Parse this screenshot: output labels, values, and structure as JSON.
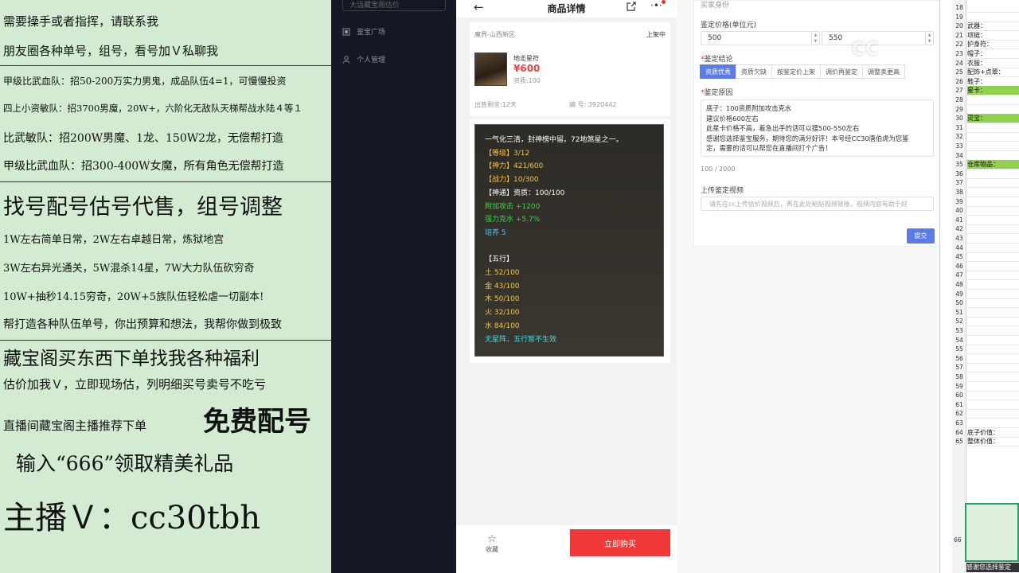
{
  "overlay": {
    "lines": [
      "需要操手或者指挥，请联系我",
      "朋友圈各种单号，组号，看号加Ｖ私聊我",
      "甲级比武血队：招50-200万实力男鬼，成品队伍4=1，可慢慢投资",
      "四上小资敏队：招3700男魔，20W+，六阶化无敌队天梯帮战水陆４等１",
      "比武敏队：招200W男魔、1龙、150W2龙，无偿帮打造",
      "甲级比武血队：招300-400W女魔，所有角色无偿帮打造",
      "找号配号估号代售，组号调整",
      "1W左右简单日常，2W左右卓越日常，炼狱地宫",
      "3W左右异光通关，5W混杀14星，7W大力队伍砍穷奇",
      "10W+抽秒14.15穷奇，20W+5族队伍轻松虐一切副本!",
      "帮打造各种队伍单号，你出预算和想法，我帮你做到极致",
      "藏宝阁买东西下单找我各种福利",
      "估价加我Ｖ，立即现场估，列明细买号卖号不吃亏",
      "直播间藏宝阁主播推荐下单",
      "免费配号",
      "输入“666”领取精美礼品",
      "主播Ｖ：cc30tbh"
    ]
  },
  "sidebar": {
    "search_placeholder": "大话藏宝阁估价",
    "items": [
      {
        "label": "鉴宝广场",
        "icon": "gallery-icon"
      },
      {
        "label": "个人管理",
        "icon": "user-icon"
      }
    ]
  },
  "phone": {
    "title": "商品详情",
    "region": "魔界-山西新区",
    "status": "上架中",
    "product_name": "地走星符",
    "price": "¥600",
    "points": "资质:100",
    "days_left": "出售剩余:12天",
    "serial": "编 号: 3920442",
    "detail_lines": [
      {
        "text": "一气化三清，封神榜中留。72地煞星之一。",
        "color": "#ffffff"
      },
      {
        "text": "【等级】3/12",
        "color": "#f5c542"
      },
      {
        "text": "【神力】421/600",
        "color": "#f5c542"
      },
      {
        "text": "【战力】10/300",
        "color": "#f5c542"
      },
      {
        "text": "【神通】资质：100/100",
        "color": "#ffffff"
      },
      {
        "text": "附加攻击 +1200",
        "color": "#38d64a"
      },
      {
        "text": "强力克水 +5.7%",
        "color": "#38d64a"
      },
      {
        "text": "培养 5",
        "color": "#4fc3ff"
      },
      {
        "text": "",
        "color": "#ffffff"
      },
      {
        "text": "【五行】",
        "color": "#ffffff"
      },
      {
        "text": "土 52/100",
        "color": "#f5c542"
      },
      {
        "text": "金 43/100",
        "color": "#f5c542"
      },
      {
        "text": "木 50/100",
        "color": "#f5c542"
      },
      {
        "text": "火 32/100",
        "color": "#f5c542"
      },
      {
        "text": "水 84/100",
        "color": "#f5c542"
      },
      {
        "text": "无星阵，五行暂不生效",
        "color": "#3de0e8"
      }
    ],
    "fav_label": "收藏",
    "buy_label": "立即购买"
  },
  "form": {
    "header": "买家身份",
    "price_label": "鉴定价格(单位元)",
    "price_min": "500",
    "price_max": "550",
    "conclusion_label": "鉴定结论",
    "conclusion_options": [
      "资质优秀",
      "资质欠缺",
      "按鉴定价上架",
      "调价再鉴定",
      "调整卖更高"
    ],
    "reason_label": "鉴定原因",
    "reason_lines": [
      "底子：100资质附加攻击克水",
      "建议价格600左右",
      "此星卡价格不高，着急出手的话可以摆500-550左右",
      "感谢您选择鉴宝服务，期待您的满分好评！本号经CC30唐伯虎为您鉴",
      "定，需要的话可以帮您在直播间打个广告！"
    ],
    "counter": "100 / 2000",
    "video_label": "上传鉴定视频",
    "video_placeholder": "请先在cc上传估价视频后，再在此处粘贴视频链接，视频内容有助于好",
    "submit_label": "提交"
  },
  "watermark": "CC",
  "sheet": {
    "rows": [
      {
        "n": "18",
        "text": "",
        "hl": false
      },
      {
        "n": "19",
        "text": "",
        "hl": false
      },
      {
        "n": "20",
        "text": "武器：",
        "hl": false
      },
      {
        "n": "21",
        "text": "项链：",
        "hl": false
      },
      {
        "n": "22",
        "text": "护身符：",
        "hl": false
      },
      {
        "n": "23",
        "text": "帽子：",
        "hl": false
      },
      {
        "n": "24",
        "text": "衣服：",
        "hl": false
      },
      {
        "n": "25",
        "text": "配饰+点翠：",
        "hl": false
      },
      {
        "n": "26",
        "text": "鞋子：",
        "hl": false
      },
      {
        "n": "27",
        "text": "星卡：",
        "hl": true
      },
      {
        "n": "28",
        "text": "",
        "hl": false
      },
      {
        "n": "29",
        "text": "",
        "hl": false
      },
      {
        "n": "30",
        "text": "灵宝：",
        "hl": true
      },
      {
        "n": "31",
        "text": "",
        "hl": false
      },
      {
        "n": "32",
        "text": "",
        "hl": false
      },
      {
        "n": "33",
        "text": "",
        "hl": false
      },
      {
        "n": "34",
        "text": "",
        "hl": false
      },
      {
        "n": "35",
        "text": "仓库物品：",
        "hl": true
      },
      {
        "n": "36",
        "text": "",
        "hl": false
      },
      {
        "n": "37",
        "text": "",
        "hl": false
      },
      {
        "n": "38",
        "text": "",
        "hl": false
      },
      {
        "n": "39",
        "text": "",
        "hl": false
      },
      {
        "n": "40",
        "text": "",
        "hl": false
      },
      {
        "n": "41",
        "text": "",
        "hl": false
      },
      {
        "n": "42",
        "text": "",
        "hl": false
      },
      {
        "n": "43",
        "text": "",
        "hl": false
      },
      {
        "n": "44",
        "text": "",
        "hl": false
      },
      {
        "n": "45",
        "text": "",
        "hl": false
      },
      {
        "n": "46",
        "text": "",
        "hl": false
      },
      {
        "n": "47",
        "text": "",
        "hl": false
      },
      {
        "n": "48",
        "text": "",
        "hl": false
      },
      {
        "n": "49",
        "text": "",
        "hl": false
      },
      {
        "n": "50",
        "text": "",
        "hl": false
      },
      {
        "n": "51",
        "text": "",
        "hl": false
      },
      {
        "n": "52",
        "text": "",
        "hl": false
      },
      {
        "n": "53",
        "text": "",
        "hl": false
      },
      {
        "n": "54",
        "text": "",
        "hl": false
      },
      {
        "n": "55",
        "text": "",
        "hl": false
      },
      {
        "n": "56",
        "text": "",
        "hl": false
      },
      {
        "n": "57",
        "text": "",
        "hl": false
      },
      {
        "n": "58",
        "text": "",
        "hl": false
      },
      {
        "n": "59",
        "text": "",
        "hl": false
      },
      {
        "n": "60",
        "text": "",
        "hl": false
      },
      {
        "n": "61",
        "text": "",
        "hl": false
      },
      {
        "n": "62",
        "text": "",
        "hl": false
      },
      {
        "n": "63",
        "text": "",
        "hl": false
      },
      {
        "n": "64",
        "text": "底子价值：",
        "hl": false
      },
      {
        "n": "65",
        "text": "整体价值：",
        "hl": false
      }
    ],
    "selected_row": "66",
    "selected_preview": "感谢您选择鉴定"
  }
}
